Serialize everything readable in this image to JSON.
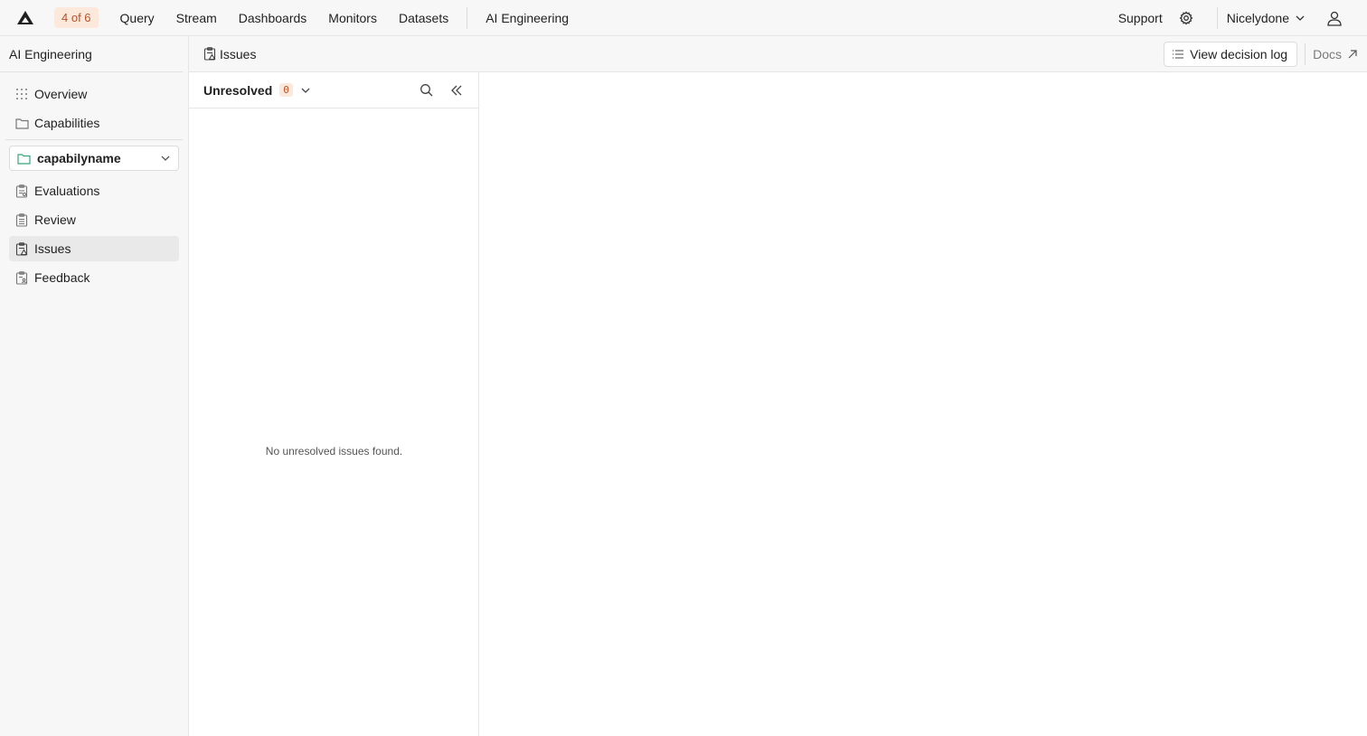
{
  "topbar": {
    "step_badge": "4 of 6",
    "nav": [
      "Query",
      "Stream",
      "Dashboards",
      "Monitors",
      "Datasets"
    ],
    "section": "AI Engineering",
    "support": "Support",
    "org": "Nicelydone"
  },
  "sidebar": {
    "title": "AI Engineering",
    "top_items": [
      {
        "label": "Overview",
        "icon": "grid-icon"
      },
      {
        "label": "Capabilities",
        "icon": "folder-icon"
      }
    ],
    "capability": "capabilyname",
    "items": [
      {
        "label": "Evaluations",
        "icon": "clipboard-check-icon"
      },
      {
        "label": "Review",
        "icon": "clipboard-list-icon"
      },
      {
        "label": "Issues",
        "icon": "clipboard-warning-icon",
        "active": true
      },
      {
        "label": "Feedback",
        "icon": "clipboard-user-icon"
      }
    ]
  },
  "header": {
    "breadcrumb": "Issues",
    "decision_log": "View decision log",
    "docs": "Docs"
  },
  "issues": {
    "filter": "Unresolved",
    "count": "0",
    "empty_message": "No unresolved issues found."
  },
  "colors": {
    "accent_bg": "#fde8dc",
    "accent_fg": "#b8522a",
    "capability_icon": "#3aa37a"
  }
}
